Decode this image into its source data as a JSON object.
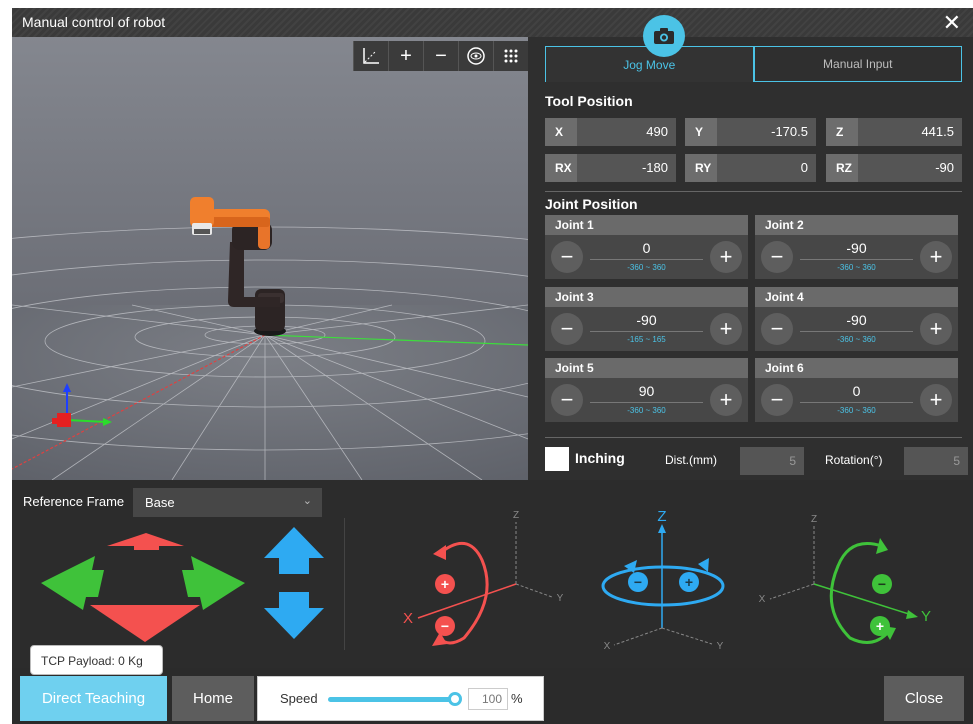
{
  "window": {
    "title": "Manual control of robot"
  },
  "tabs": [
    {
      "label": "Jog Move"
    },
    {
      "label": "Manual Input"
    }
  ],
  "tool_position": {
    "title": "Tool Position",
    "fields": [
      {
        "label": "X",
        "value": "490"
      },
      {
        "label": "Y",
        "value": "-170.5"
      },
      {
        "label": "Z",
        "value": "441.5"
      },
      {
        "label": "RX",
        "value": "-180"
      },
      {
        "label": "RY",
        "value": "0"
      },
      {
        "label": "RZ",
        "value": "-90"
      }
    ]
  },
  "joint_position": {
    "title": "Joint Position",
    "joints": [
      {
        "label": "Joint 1",
        "value": "0",
        "range": "-360 ~ 360"
      },
      {
        "label": "Joint 2",
        "value": "-90",
        "range": "-360 ~ 360"
      },
      {
        "label": "Joint 3",
        "value": "-90",
        "range": "-165 ~ 165"
      },
      {
        "label": "Joint 4",
        "value": "-90",
        "range": "-360 ~ 360"
      },
      {
        "label": "Joint 5",
        "value": "90",
        "range": "-360 ~ 360"
      },
      {
        "label": "Joint 6",
        "value": "0",
        "range": "-360 ~ 360"
      }
    ]
  },
  "inching": {
    "label": "Inching",
    "dist_label": "Dist.(mm)",
    "dist_value": "5",
    "rot_label": "Rotation(°)",
    "rot_value": "5"
  },
  "reference": {
    "label": "Reference Frame",
    "value": "Base"
  },
  "axes": {
    "x": "X",
    "y": "Y",
    "z": "Z",
    "plus": "+",
    "minus": "−"
  },
  "footer": {
    "tooltip": "TCP Payload: 0 Kg",
    "direct_teaching": "Direct Teaching",
    "home": "Home",
    "speed_label": "Speed",
    "speed_value": "100",
    "speed_unit": "%",
    "close": "Close"
  },
  "colors": {
    "accent": "#4bc3e6",
    "red": "#f4514f",
    "green": "#3fc23a",
    "blue": "#2ea8f0"
  },
  "icons": [
    "camera-icon",
    "axes-toggle-icon",
    "zoom-in-icon",
    "zoom-out-icon",
    "eye-icon",
    "grid-dots-icon",
    "close-icon"
  ]
}
